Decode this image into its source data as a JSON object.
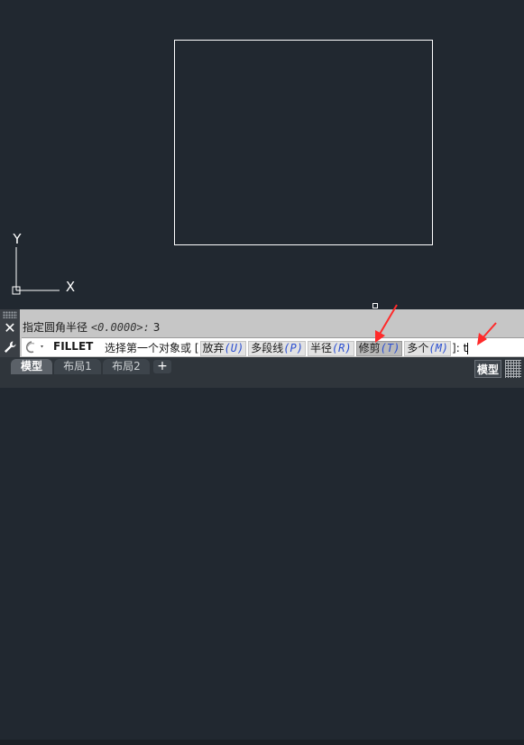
{
  "ucs": {
    "y_label": "Y",
    "x_label": "X"
  },
  "command_history": {
    "text": "指定圆角半径",
    "default_value": "<0.0000>:",
    "entered": "3"
  },
  "command_line": {
    "name": "FILLET",
    "prompt": "选择第一个对象或",
    "bracket_open": "[",
    "options": [
      {
        "label": "放弃",
        "key": "(U)"
      },
      {
        "label": "多段线",
        "key": "(P)"
      },
      {
        "label": "半径",
        "key": "(R)"
      },
      {
        "label": "修剪",
        "key": "(T)"
      },
      {
        "label": "多个",
        "key": "(M)"
      }
    ],
    "bracket_close": "]:",
    "typed": "t"
  },
  "tabs": {
    "model": "模型",
    "layout1": "布局1",
    "layout2": "布局2",
    "add": "+"
  },
  "status": {
    "model": "模型"
  },
  "colors": {
    "canvas": "#212830",
    "arrow": "#ff2a2a",
    "option_key": "#2b4fd1"
  }
}
